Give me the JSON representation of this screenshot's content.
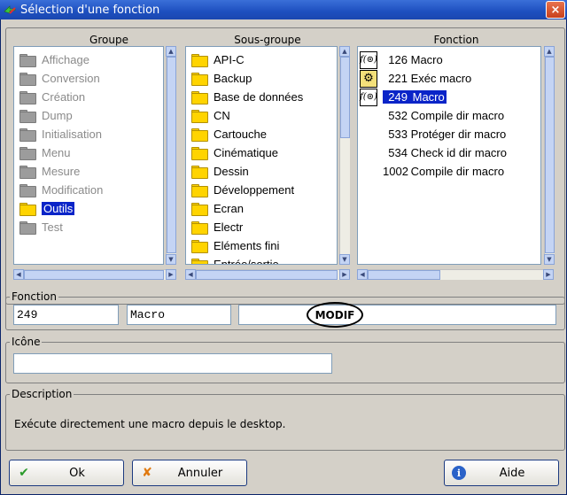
{
  "window": {
    "title": "Sélection d'une fonction",
    "close_label": "×"
  },
  "headers": {
    "groupe": "Groupe",
    "sous_groupe": "Sous-groupe",
    "fonction": "Fonction"
  },
  "groupe": [
    {
      "label": "Affichage"
    },
    {
      "label": "Conversion"
    },
    {
      "label": "Création"
    },
    {
      "label": "Dump"
    },
    {
      "label": "Initialisation"
    },
    {
      "label": "Menu"
    },
    {
      "label": "Mesure"
    },
    {
      "label": "Modification"
    },
    {
      "label": "Outils"
    },
    {
      "label": "Test"
    }
  ],
  "groupe_selected": "Outils",
  "sous_groupe": [
    {
      "label": "API-C"
    },
    {
      "label": "Backup"
    },
    {
      "label": "Base de données"
    },
    {
      "label": "CN"
    },
    {
      "label": "Cartouche"
    },
    {
      "label": "Cinématique"
    },
    {
      "label": "Dessin"
    },
    {
      "label": "Développement"
    },
    {
      "label": "Ecran"
    },
    {
      "label": "Electr"
    },
    {
      "label": "Eléments fini"
    },
    {
      "label": "Entrée/sortie"
    }
  ],
  "fonction": [
    {
      "num": "126",
      "label": "Macro",
      "icon": "f-circle-icon"
    },
    {
      "num": "221",
      "label": "Exéc macro",
      "icon": "exec-icon"
    },
    {
      "num": "249",
      "label": "Macro",
      "icon": "f-circle-icon"
    },
    {
      "num": "532",
      "label": "Compile dir macro",
      "icon": ""
    },
    {
      "num": "533",
      "label": "Protéger dir macro",
      "icon": ""
    },
    {
      "num": "534",
      "label": "Check id dir macro",
      "icon": ""
    },
    {
      "num": "1002",
      "label": "Compile dir macro",
      "icon": ""
    }
  ],
  "fonction_selected_index": 2,
  "fonction_section": {
    "legend": "Fonction",
    "num_value": "249",
    "name_value": "Macro",
    "tag": "MODIF"
  },
  "icone_section": {
    "legend": "Icône",
    "value": ""
  },
  "description_section": {
    "legend": "Description",
    "text": "Exécute directement une macro depuis le desktop."
  },
  "buttons": {
    "ok": "Ok",
    "annuler": "Annuler",
    "aide": "Aide"
  },
  "colors": {
    "selection": "#0a24c8",
    "title_bar": "#1d4fbf",
    "dialog_bg": "#d4d0c8"
  }
}
